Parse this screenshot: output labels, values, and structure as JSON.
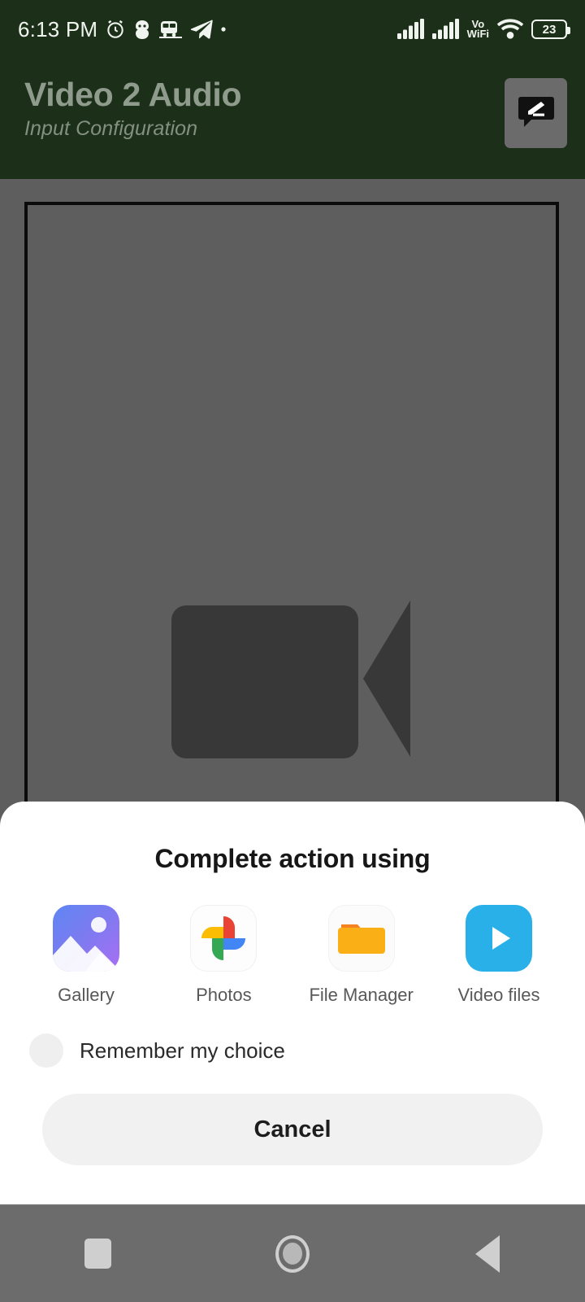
{
  "status_bar": {
    "time": "6:13 PM",
    "left_icons": [
      "alarm-clock-icon",
      "face-icon",
      "train-icon",
      "telegram-icon",
      "dot-icon"
    ],
    "right_icons": [
      "signal-bars-sim1-icon",
      "signal-bars-sim2-icon",
      "vowifi-label",
      "wifi-icon",
      "battery-icon"
    ],
    "vowifi_top": "Vo",
    "vowifi_bottom": "WiFi",
    "battery_percent": "23",
    "background_color": "#1c3019",
    "foreground_color": "#f0f4ee"
  },
  "app_header": {
    "title": "Video 2 Audio",
    "subtitle": "Input Configuration",
    "action_icon": "feedback-icon",
    "title_color": "#8f9b8c",
    "background_color": "#1c3019"
  },
  "content": {
    "placeholder_icon": "video-camera-icon",
    "background_color": "#5e5e5e",
    "frame_border_color": "#0b0b0b"
  },
  "sheet": {
    "title": "Complete action using",
    "apps": [
      {
        "label": "Gallery",
        "icon": "gallery-icon",
        "color": "#7b7bf0"
      },
      {
        "label": "Photos",
        "icon": "google-photos-icon",
        "color": "#ffffff"
      },
      {
        "label": "File Manager",
        "icon": "folder-icon",
        "color": "#f9ab1f"
      },
      {
        "label": "Video files",
        "icon": "play-icon",
        "color": "#29b0e8"
      }
    ],
    "remember_label": "Remember my choice",
    "remember_checked": false,
    "cancel_label": "Cancel",
    "background_color": "#ffffff"
  },
  "nav_bar": {
    "buttons": [
      {
        "name": "recents-button",
        "icon": "square-icon"
      },
      {
        "name": "home-button",
        "icon": "circle-icon"
      },
      {
        "name": "back-button",
        "icon": "triangle-left-icon"
      }
    ],
    "background_color": "#6c6c6c"
  }
}
